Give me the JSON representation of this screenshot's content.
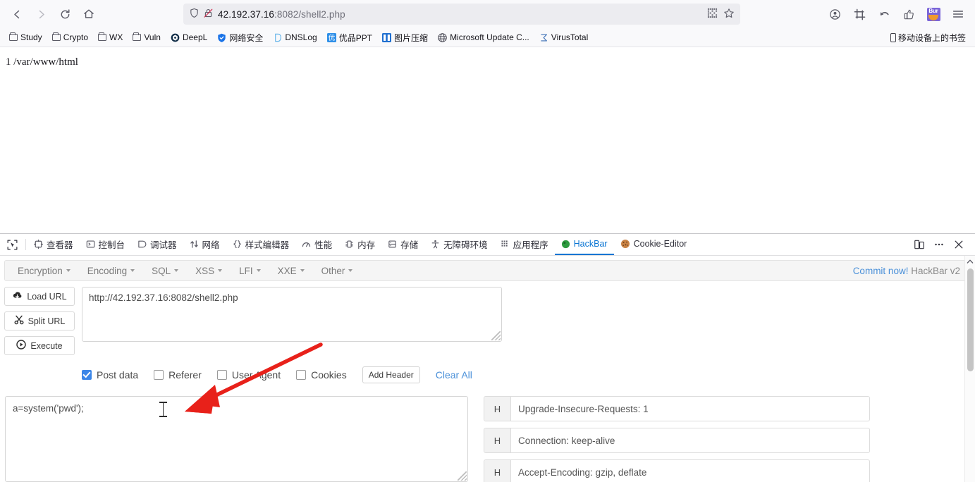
{
  "browser": {
    "nav": {
      "back_icon": "arrow-left-icon",
      "forward_icon": "arrow-right-icon",
      "reload_icon": "reload-icon",
      "home_icon": "home-icon"
    },
    "urlbar": {
      "shield_icon": "shield-icon",
      "lock_icon": "lock-broken-icon",
      "url_host": "42.192.37.16",
      "url_rest": ":8082/shell2.php",
      "full_url": "42.192.37.16:8082/shell2.php",
      "qr_icon": "qr-code-icon",
      "bookmark_icon": "star-icon"
    },
    "toolbar_right": [
      {
        "name": "account-icon",
        "label": ""
      },
      {
        "name": "screenshot-icon",
        "label": ""
      },
      {
        "name": "undo-icon",
        "label": ""
      },
      {
        "name": "thumbs-up-icon",
        "label": ""
      },
      {
        "name": "burp-extension-icon",
        "label": "Bur"
      },
      {
        "name": "app-menu-icon",
        "label": ""
      }
    ]
  },
  "bookmarks": {
    "items": [
      {
        "label": "Study",
        "icon": "folder-icon"
      },
      {
        "label": "Crypto",
        "icon": "folder-icon"
      },
      {
        "label": "WX",
        "icon": "folder-icon"
      },
      {
        "label": "Vuln",
        "icon": "folder-icon"
      },
      {
        "label": "DeepL",
        "icon": "deepl-favicon"
      },
      {
        "label": "网络安全",
        "icon": "shield-favicon"
      },
      {
        "label": "DNSLog",
        "icon": "dnslog-favicon"
      },
      {
        "label": "优品PPT",
        "icon": "youpinppt-favicon"
      },
      {
        "label": "图片压缩",
        "icon": "image-compress-favicon"
      },
      {
        "label": "Microsoft Update C...",
        "icon": "globe-favicon"
      },
      {
        "label": "VirusTotal",
        "icon": "virustotal-favicon"
      }
    ],
    "mobile_label": "移动设备上的书签",
    "mobile_icon": "phone-icon"
  },
  "page": {
    "content_line": "1 /var/www/html"
  },
  "devtools": {
    "picker_icon": "element-picker-icon",
    "tabs": [
      {
        "label": "查看器",
        "icon": "inspector-icon",
        "active": false
      },
      {
        "label": "控制台",
        "icon": "console-icon",
        "active": false
      },
      {
        "label": "调试器",
        "icon": "debugger-icon",
        "active": false
      },
      {
        "label": "网络",
        "icon": "network-icon",
        "active": false
      },
      {
        "label": "样式编辑器",
        "icon": "style-editor-icon",
        "active": false
      },
      {
        "label": "性能",
        "icon": "performance-icon",
        "active": false
      },
      {
        "label": "内存",
        "icon": "memory-icon",
        "active": false
      },
      {
        "label": "存储",
        "icon": "storage-icon",
        "active": false
      },
      {
        "label": "无障碍环境",
        "icon": "accessibility-icon",
        "active": false
      },
      {
        "label": "应用程序",
        "icon": "application-icon",
        "active": false
      },
      {
        "label": "HackBar",
        "icon": "hackbar-icon",
        "active": true
      },
      {
        "label": "Cookie-Editor",
        "icon": "cookie-icon",
        "active": false
      }
    ],
    "right_buttons": [
      {
        "name": "responsive-design-mode-icon"
      },
      {
        "name": "devtools-meatball-menu-icon"
      },
      {
        "name": "devtools-close-icon"
      }
    ]
  },
  "hackbar": {
    "menus": [
      {
        "label": "Encryption"
      },
      {
        "label": "Encoding"
      },
      {
        "label": "SQL"
      },
      {
        "label": "XSS"
      },
      {
        "label": "LFI"
      },
      {
        "label": "XXE"
      },
      {
        "label": "Other"
      }
    ],
    "commit_link": "Commit now!",
    "version_label": "HackBar v2",
    "actions": [
      {
        "label": "Load URL",
        "icon": "cloud-download-icon"
      },
      {
        "label": "Split URL",
        "icon": "scissors-icon"
      },
      {
        "label": "Execute",
        "icon": "play-circle-icon"
      }
    ],
    "url_value": "http://42.192.37.16:8082/shell2.php",
    "options": [
      {
        "label": "Post data",
        "checked": true
      },
      {
        "label": "Referer",
        "checked": false
      },
      {
        "label": "User Agent",
        "checked": false
      },
      {
        "label": "Cookies",
        "checked": false
      }
    ],
    "add_header_label": "Add Header",
    "clear_all_label": "Clear All",
    "post_data_value": "a=system('pwd');",
    "headers": [
      {
        "key": "H",
        "value": "Upgrade-Insecure-Requests: 1"
      },
      {
        "key": "H",
        "value": "Connection: keep-alive"
      },
      {
        "key": "H",
        "value": "Accept-Encoding: gzip, deflate"
      }
    ]
  },
  "annotation": {
    "arrow_color": "#e8211a",
    "arrow_name": "red-pointer-arrow"
  },
  "colors": {
    "accent_blue": "#0a75d3",
    "link_blue": "#4a90d9",
    "checkbox_blue": "#3b86e8",
    "chrome_bg": "#f9f9fb"
  }
}
